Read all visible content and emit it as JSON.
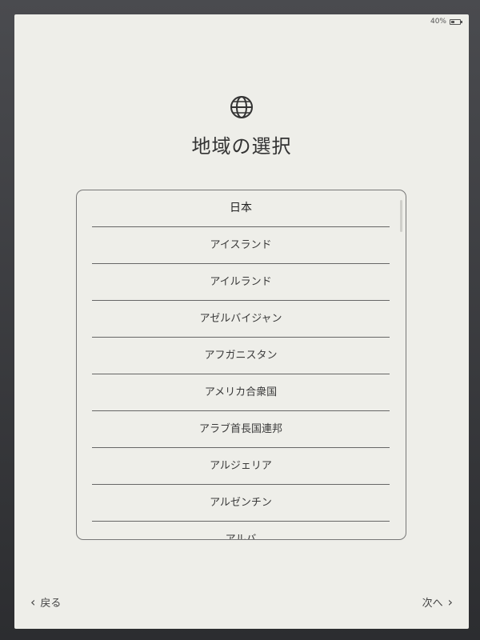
{
  "status": {
    "battery_text": "40%",
    "battery_level": 0.4
  },
  "header": {
    "icon": "globe-icon",
    "title": "地域の選択"
  },
  "regions": [
    "日本",
    "アイスランド",
    "アイルランド",
    "アゼルバイジャン",
    "アフガニスタン",
    "アメリカ合衆国",
    "アラブ首長国連邦",
    "アルジェリア",
    "アルゼンチン",
    "アルバ"
  ],
  "selected_index": 0,
  "footer": {
    "back_label": "戻る",
    "next_label": "次へ"
  },
  "colors": {
    "screen_bg": "#eeeee9",
    "text": "#333333"
  }
}
